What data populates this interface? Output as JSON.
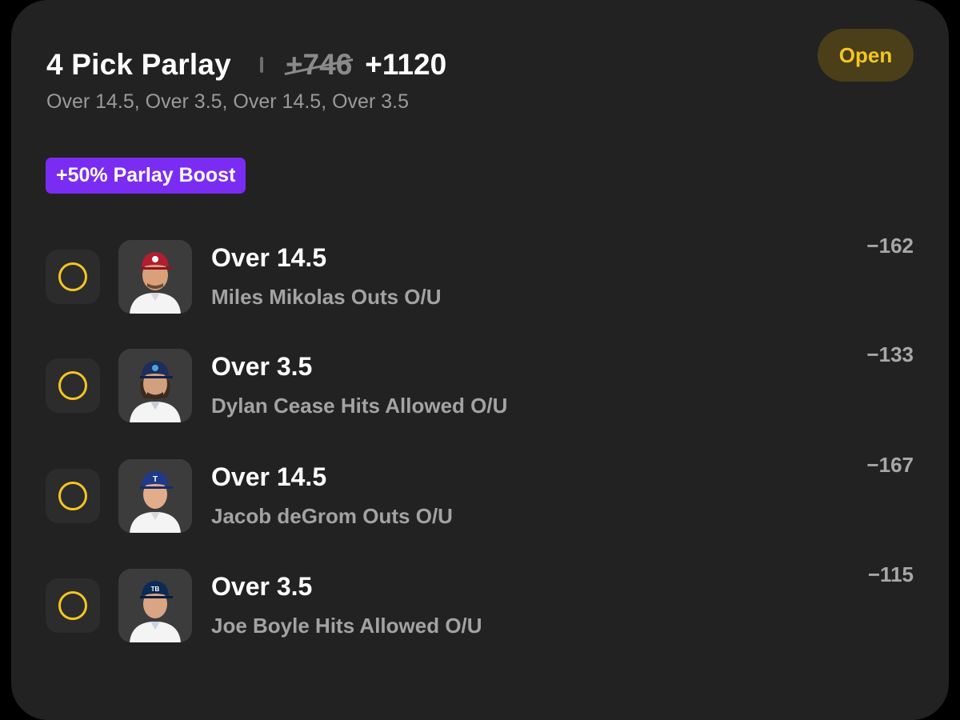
{
  "parlay": {
    "title": "4 Pick Parlay",
    "old_odds": "+746",
    "new_odds": "+1120",
    "summary": "Over 14.5, Over 3.5, Over 14.5, Over 3.5",
    "status": "Open",
    "boost_label": "+50% Parlay Boost"
  },
  "colors": {
    "card_bg": "#222222",
    "status_bg": "#4a3f18",
    "status_text": "#f3c623",
    "boost_bg": "#7b2cf2",
    "pending_circle": "#f3c623"
  },
  "legs": [
    {
      "line": "Over 14.5",
      "market": "Miles Mikolas Outs O/U",
      "odds": "−162",
      "avatar_icon": "player-headshot-icon",
      "team_color": "#b01e2f",
      "status_icon": "pending-circle-icon"
    },
    {
      "line": "Over 3.5",
      "market": "Dylan Cease Hits Allowed O/U",
      "odds": "−133",
      "avatar_icon": "player-headshot-icon",
      "team_color": "#1d2d5c",
      "status_icon": "pending-circle-icon"
    },
    {
      "line": "Over 14.5",
      "market": "Jacob deGrom Outs O/U",
      "odds": "−167",
      "avatar_icon": "player-headshot-icon",
      "team_color": "#1f3a8a",
      "status_icon": "pending-circle-icon"
    },
    {
      "line": "Over 3.5",
      "market": "Joe Boyle Hits Allowed O/U",
      "odds": "−115",
      "avatar_icon": "player-headshot-icon",
      "team_color": "#0b2a55",
      "status_icon": "pending-circle-icon"
    }
  ]
}
